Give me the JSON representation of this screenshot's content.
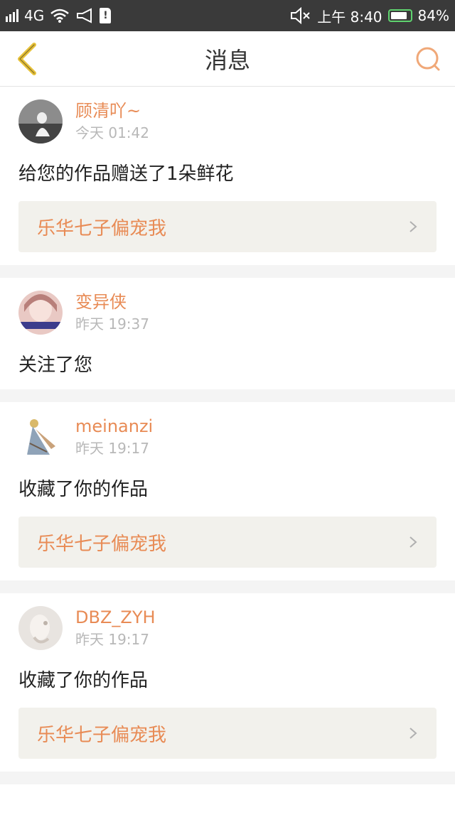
{
  "status": {
    "network": "4G",
    "time": "上午 8:40",
    "battery": "84%",
    "battery_level": 0.84
  },
  "header": {
    "title": "消息"
  },
  "messages": [
    {
      "username": "顾清吖~",
      "time": "今天 01:42",
      "text": "给您的作品赠送了1朵鲜花",
      "work_title": "乐华七子偏宠我",
      "has_work": true
    },
    {
      "username": "变异侠",
      "time": "昨天 19:37",
      "text": "关注了您",
      "work_title": "",
      "has_work": false
    },
    {
      "username": "meinanzi",
      "time": "昨天 19:17",
      "text": "收藏了你的作品",
      "work_title": "乐华七子偏宠我",
      "has_work": true
    },
    {
      "username": "DBZ_ZYH",
      "time": "昨天 19:17",
      "text": "收藏了你的作品",
      "work_title": "乐华七子偏宠我",
      "has_work": true
    }
  ],
  "colors": {
    "accent": "#e88b55",
    "link_bg": "#f2f1ec",
    "battery_border": "#5fd36f"
  }
}
